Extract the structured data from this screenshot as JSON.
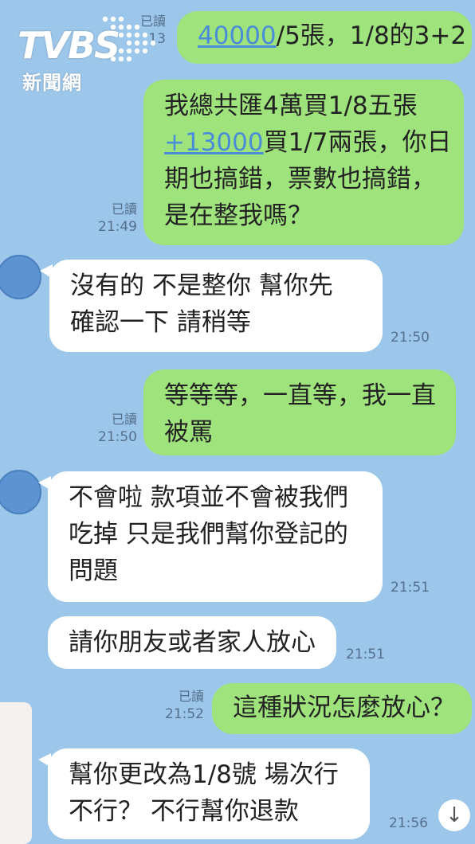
{
  "watermark": {
    "brand": "TVBS",
    "subtitle": "新聞網"
  },
  "messages": [
    {
      "dir": "out",
      "read": "已讀",
      "time": "13",
      "lines": [
        {
          "link": "40000",
          "text": "/5張，1/8的3+2"
        }
      ]
    },
    {
      "dir": "out",
      "read": "已讀",
      "time": "21:49",
      "lines": [
        {
          "text": "我總共匯4萬買1/8五張"
        },
        {
          "link": "+13000",
          "text": "買1/7兩張，你日"
        },
        {
          "text": "期也搞錯，票數也搞錯，"
        },
        {
          "text": "是在整我嗎？"
        }
      ]
    },
    {
      "dir": "in",
      "time": "21:50",
      "lines": [
        {
          "text": "沒有的 不是整你  幫你先"
        },
        {
          "text": "確認一下 請稍等"
        }
      ]
    },
    {
      "dir": "out",
      "read": "已讀",
      "time": "21:50",
      "lines": [
        {
          "text": "等等等，一直等，我一直"
        },
        {
          "text": "被罵"
        }
      ]
    },
    {
      "dir": "in",
      "time": "21:51",
      "lines": [
        {
          "text": "不會啦 款項並不會被我們"
        },
        {
          "text": "吃掉 只是我們幫你登記的"
        },
        {
          "text": "問題"
        }
      ]
    },
    {
      "dir": "in",
      "time": "21:51",
      "lines": [
        {
          "text": "請你朋友或者家人放心"
        }
      ]
    },
    {
      "dir": "out",
      "read": "已讀",
      "time": "21:52",
      "lines": [
        {
          "text": "這種狀況怎麼放心？"
        }
      ]
    },
    {
      "dir": "in",
      "time": "21:56",
      "lines": [
        {
          "text": "幫你更改為1/8號 場次行"
        },
        {
          "text": "不行？ 不行幫你退款"
        }
      ]
    }
  ],
  "icons": {
    "scroll": "arrow-down-icon",
    "avatar": "avatar-circle"
  },
  "colors": {
    "background": "#9cc6ea",
    "outgoing": "#9fe37d",
    "incoming": "#ffffff",
    "avatar": "#5e93d2"
  },
  "scroll_symbol": "↓"
}
